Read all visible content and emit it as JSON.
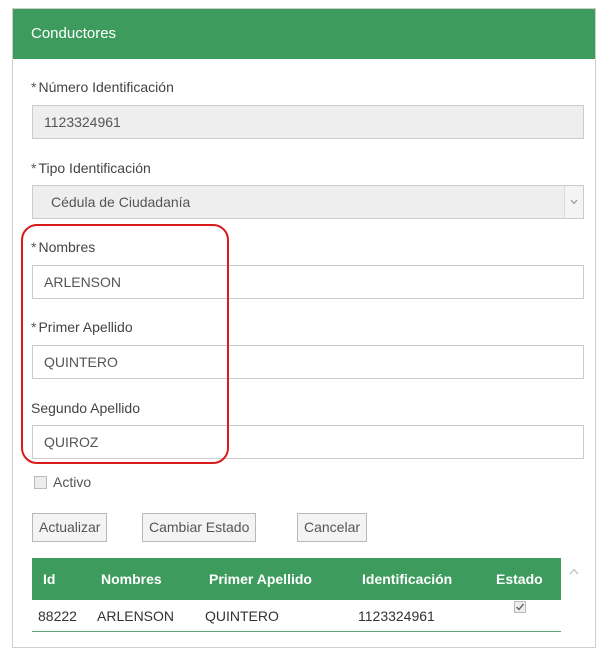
{
  "panel": {
    "title": "Conductores"
  },
  "form": {
    "id_number": {
      "label": "Número Identificación",
      "required_mark": "*",
      "value": "1123324961"
    },
    "id_type": {
      "label": "Tipo Identificación",
      "required_mark": "*",
      "value": "Cédula de Ciudadanía"
    },
    "names": {
      "label": "Nombres",
      "required_mark": "*",
      "value": "ARLENSON"
    },
    "first_surname": {
      "label": "Primer Apellido",
      "required_mark": "*",
      "value": "QUINTERO"
    },
    "second_surname": {
      "label": "Segundo Apellido",
      "value": "QUIROZ"
    },
    "active": {
      "label": "Activo",
      "checked": false
    }
  },
  "buttons": {
    "update": "Actualizar",
    "change_state": "Cambiar Estado",
    "cancel": "Cancelar"
  },
  "grid": {
    "columns": [
      "Id",
      "Nombres",
      "Primer Apellido",
      "Identificación",
      "Estado"
    ],
    "rows": [
      {
        "id": "88222",
        "nombres": "ARLENSON",
        "primer_apellido": "QUINTERO",
        "identificacion": "1123324961",
        "estado": true
      }
    ]
  },
  "colors": {
    "header": "#3e9b5e",
    "highlight": "#d91a1a"
  }
}
